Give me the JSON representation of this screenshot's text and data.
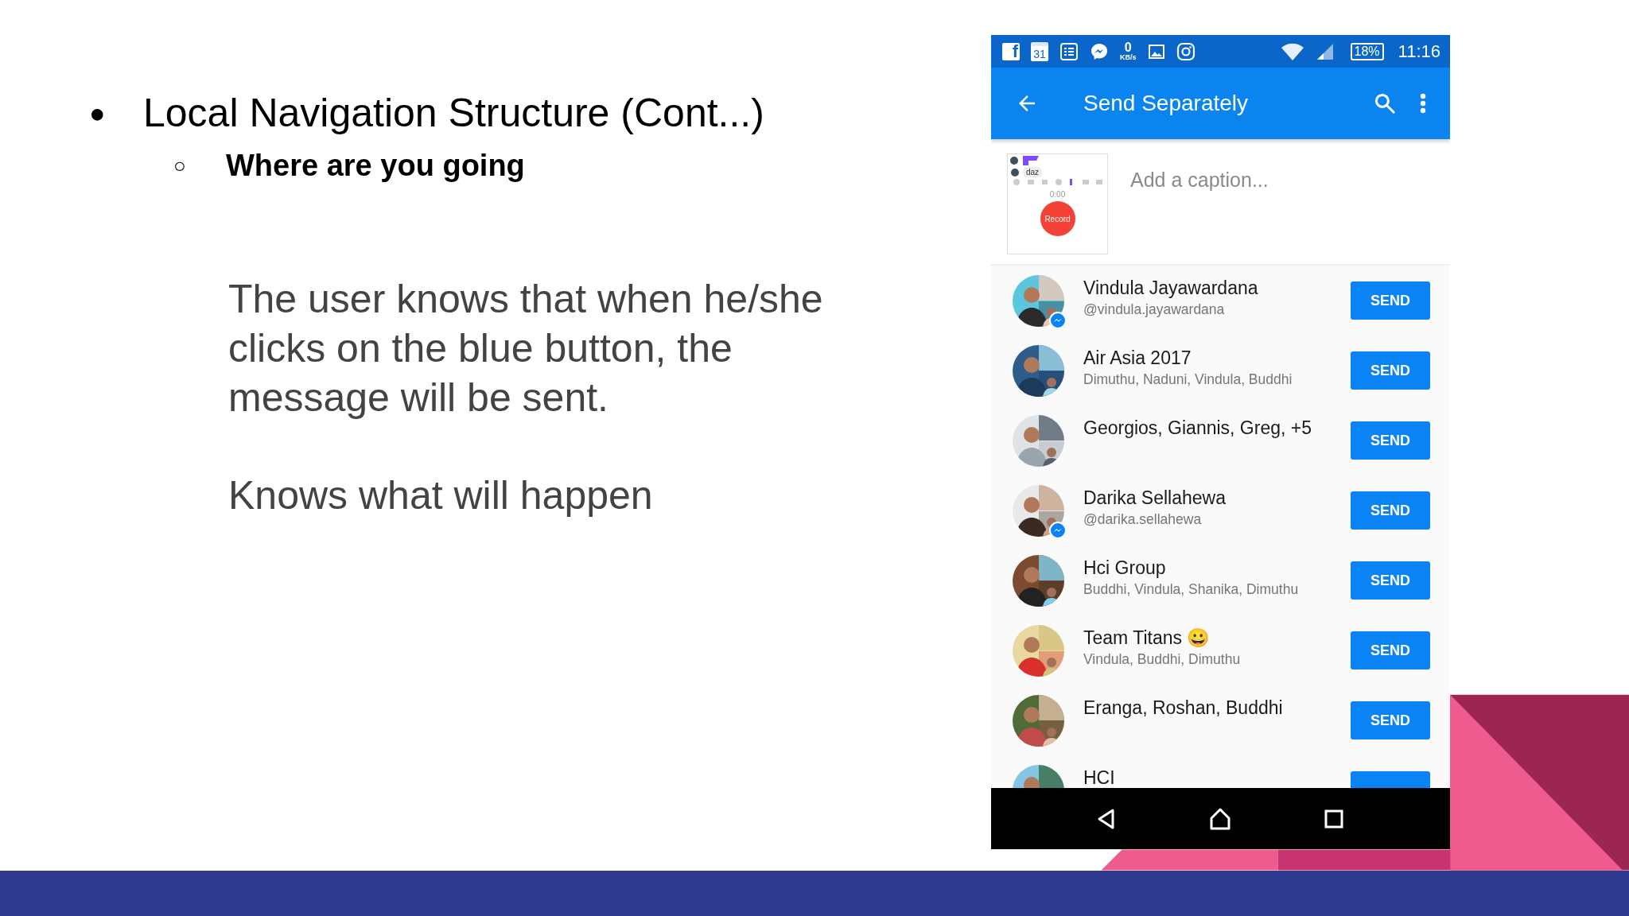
{
  "slide": {
    "bullets": [
      {
        "marker": "●",
        "text": "Local Navigation Structure (Cont...)",
        "children": [
          {
            "marker": "○",
            "text": "Where are you going"
          }
        ]
      }
    ],
    "paragraphs": [
      "The user knows that when he/she clicks on the blue button, the message will be sent.",
      "Knows what will happen"
    ]
  },
  "phone": {
    "status_bar": {
      "icons": [
        {
          "kind": "facebook",
          "glyph": "f"
        },
        {
          "kind": "calendar",
          "text": "31"
        },
        {
          "kind": "news"
        },
        {
          "kind": "messenger"
        },
        {
          "kind": "data_speed",
          "value": "0",
          "unit": "KB/s"
        },
        {
          "kind": "gallery"
        },
        {
          "kind": "instagram"
        }
      ],
      "battery": "18%",
      "time": "11:16"
    },
    "app_bar": {
      "title": "Send Separately"
    },
    "caption": {
      "placeholder": "Add a caption...",
      "attachment": {
        "bubble": "daz",
        "timer": "0:00",
        "record_label": "Record"
      }
    },
    "contacts": [
      {
        "name": "Vindula Jayawardana",
        "subtitle": "@vindula.jayawardana",
        "messenger_badge": true,
        "button": "SEND"
      },
      {
        "name": "Air Asia 2017",
        "subtitle": "Dimuthu, Naduni, Vindula, Buddhi",
        "messenger_badge": false,
        "button": "SEND"
      },
      {
        "name": "Georgios, Giannis, Greg, +5",
        "messenger_badge": false,
        "button": "SEND"
      },
      {
        "name": "Darika Sellahewa",
        "subtitle": "@darika.sellahewa",
        "messenger_badge": true,
        "button": "SEND"
      },
      {
        "name": "Hci Group",
        "subtitle": "Buddhi, Vindula, Shanika, Dimuthu",
        "messenger_badge": false,
        "button": "SEND"
      },
      {
        "name": "Team Titans 😀",
        "subtitle": "Vindula, Buddhi, Dimuthu",
        "messenger_badge": false,
        "button": "SEND"
      },
      {
        "name": "Eranga, Roshan, Buddhi",
        "messenger_badge": false,
        "button": "SEND"
      },
      {
        "name": "HCI",
        "messenger_badge": false
      }
    ]
  }
}
